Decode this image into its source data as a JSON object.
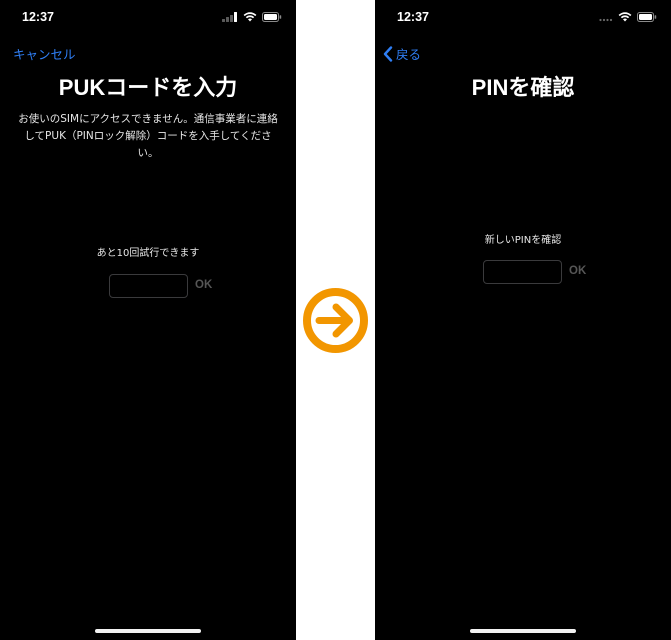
{
  "left_screen": {
    "status_time": "12:37",
    "nav": {
      "cancel_label": "キャンセル"
    },
    "title": "PUKコードを入力",
    "description": "お使いのSIMにアクセスできません。通信事業者に連絡してPUK（PINロック解除）コードを入手してください。",
    "attempts_label": "あと10回試行できます",
    "puk_input": {
      "value": "",
      "placeholder": ""
    },
    "ok_label": "OK"
  },
  "right_screen": {
    "status_time": "12:37",
    "nav": {
      "back_label": "戻る"
    },
    "title": "PINを確認",
    "new_pin_label": "新しいPINを確認",
    "pin_input": {
      "value": "",
      "placeholder": ""
    },
    "ok_label": "OK"
  },
  "icons": {
    "arrow": "right-arrow-circle-icon",
    "cellular": "cellular-signal-icon",
    "wifi": "wifi-icon",
    "battery": "battery-icon",
    "back": "chevron-left-icon"
  },
  "colors": {
    "screen_background": "#000000",
    "link_blue": "#2f7ff6",
    "arrow_orange": "#f29600",
    "disabled_ok": "#565656"
  }
}
